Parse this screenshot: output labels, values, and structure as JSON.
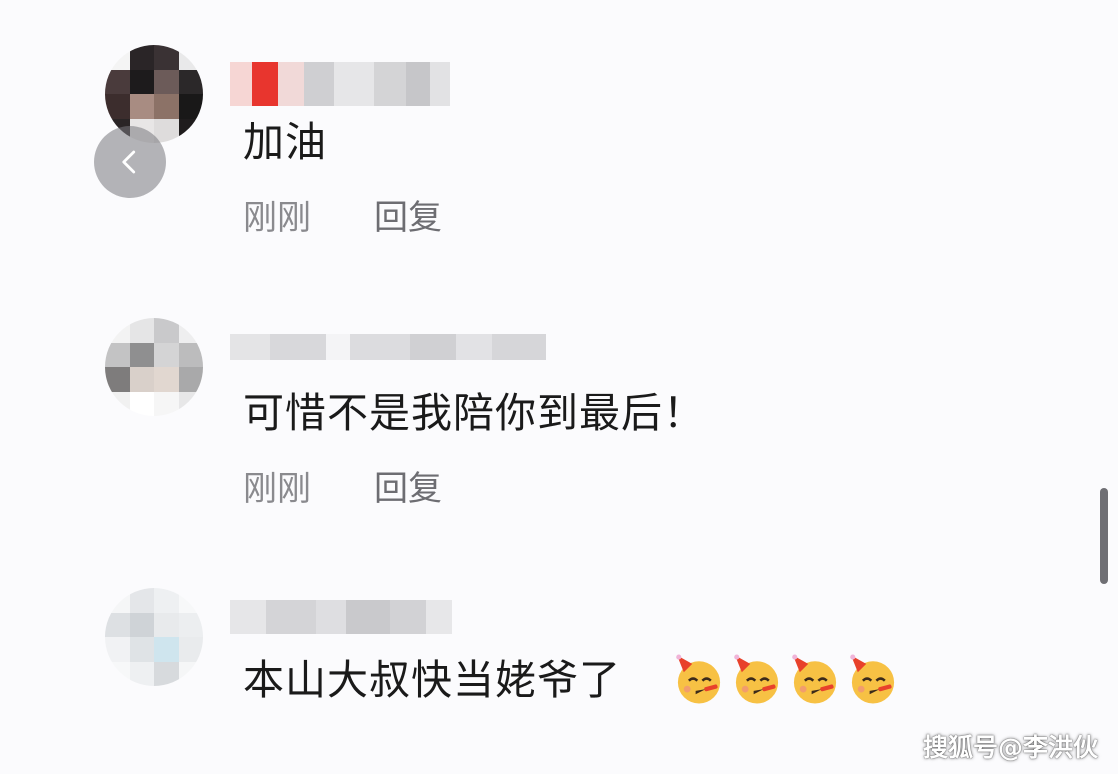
{
  "comments": [
    {
      "text": "加油",
      "time": "刚刚",
      "reply_label": "回复"
    },
    {
      "text": "可惜不是我陪你到最后！",
      "time": "刚刚",
      "reply_label": "回复"
    },
    {
      "text": "本山大叔快当姥爷了",
      "emoji": [
        "party-face-emoji",
        "party-face-emoji",
        "party-face-emoji",
        "party-face-emoji"
      ]
    }
  ],
  "watermark": "搜狐号@李洪伙",
  "colors": {
    "background": "#fbfbfd",
    "text": "#1a1a1a",
    "meta": "#8a8a8e",
    "scrollbar": "#6f6f74"
  },
  "icons": {
    "back": "chevron-left-icon"
  }
}
